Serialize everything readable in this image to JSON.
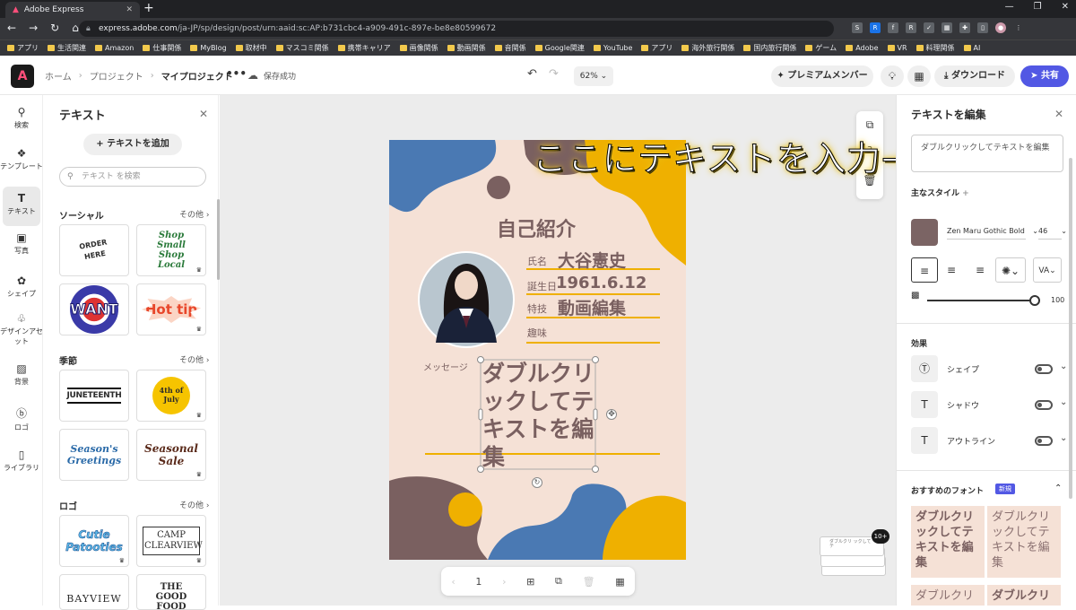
{
  "browser": {
    "tab_title": "Adobe Express",
    "url_domain": "express.adobe.com",
    "url_path": "/ja-JP/sp/design/post/urn:aaid:sc:AP:b731cbc4-a909-491c-897e-be8e80599672",
    "bookmarks": [
      "アプリ",
      "生活関連",
      "Amazon",
      "仕事関係",
      "MyBlog",
      "取材中",
      "マスコミ関係",
      "携帯キャリア",
      "画像関係",
      "動画関係",
      "音関係",
      "Google関連",
      "YouTube",
      "アプリ",
      "海外旅行関係",
      "国内旅行関係",
      "ゲーム",
      "Adobe",
      "VR",
      "料理関係",
      "AI"
    ]
  },
  "header": {
    "breadcrumbs": [
      "ホーム",
      "プロジェクト",
      "マイプロジェクト"
    ],
    "save_status": "保存成功",
    "zoom": "62%",
    "premium_label": "プレミアムメンバー",
    "download_label": "ダウンロード",
    "share_label": "共有"
  },
  "rail": [
    {
      "label": "検索",
      "icon": "search-icon",
      "glyph": "⚲"
    },
    {
      "label": "テンプレート",
      "icon": "template-icon",
      "glyph": "❖"
    },
    {
      "label": "テキスト",
      "icon": "text-icon",
      "glyph": "T"
    },
    {
      "label": "写真",
      "icon": "photo-icon",
      "glyph": "▣"
    },
    {
      "label": "シェイプ",
      "icon": "shape-icon",
      "glyph": "✿"
    },
    {
      "label": "デザインアセット",
      "icon": "asset-icon",
      "glyph": "♧"
    },
    {
      "label": "背景",
      "icon": "background-icon",
      "glyph": "▨"
    },
    {
      "label": "ロゴ",
      "icon": "logo-icon",
      "glyph": "ⓑ"
    },
    {
      "label": "ライブラリ",
      "icon": "library-icon",
      "glyph": "▯"
    }
  ],
  "text_panel": {
    "title": "テキスト",
    "add_text": "テキストを追加",
    "search_placeholder": "テキスト を検索",
    "see_more": "その他",
    "sections": [
      {
        "name": "ソーシャル",
        "cards": [
          "ORDER HERE",
          "Shop Small Shop Local",
          "WANT",
          "Hot tip"
        ]
      },
      {
        "name": "季節",
        "cards": [
          "JUNETEENTH",
          "4th of July",
          "Season's Greetings",
          "Seasonal Sale"
        ]
      },
      {
        "name": "ロゴ",
        "cards": [
          "Cutie Patooties",
          "CAMP CLEARVIEW",
          "BAYVIEW",
          "THE GOOD FOOD"
        ]
      }
    ]
  },
  "design": {
    "title": "自己紹介",
    "rows": [
      {
        "label": "氏名",
        "value": "大谷憲史"
      },
      {
        "label": "誕生日",
        "value": "1961.6.12"
      },
      {
        "label": "特技",
        "value": "動画編集"
      },
      {
        "label": "趣味",
        "value": ""
      }
    ],
    "message_label": "メッセージ",
    "message_lines": [
      "ダブルクリ",
      "ックしてテ",
      "キストを編",
      "集"
    ]
  },
  "overlay_caption": "ここにテキストを入力→",
  "page_nav": {
    "page_number": "1"
  },
  "thumb_badge": "10+",
  "edit_panel": {
    "title": "テキストを編集",
    "input_value": "ダブルクリックしてテキストを編集",
    "main_style": "主なスタイル",
    "font_name": "Zen Maru Gothic Bold",
    "font_size": "46",
    "opacity_value": "100",
    "effects_title": "効果",
    "effects": [
      "シェイプ",
      "シャドウ",
      "アウトライン"
    ],
    "recommended_title": "おすすめのフォント",
    "new_badge": "新規",
    "font_sample_lines": [
      "ダブルクリ",
      "ックしてテ",
      "キストを編",
      "集"
    ],
    "text_color": "#7b6464"
  },
  "colors": {
    "accent": "#5258e4",
    "page_bg": "#f5e1d6",
    "blue": "#4a79b3",
    "yellow": "#efb000",
    "brown": "#7a6060"
  }
}
